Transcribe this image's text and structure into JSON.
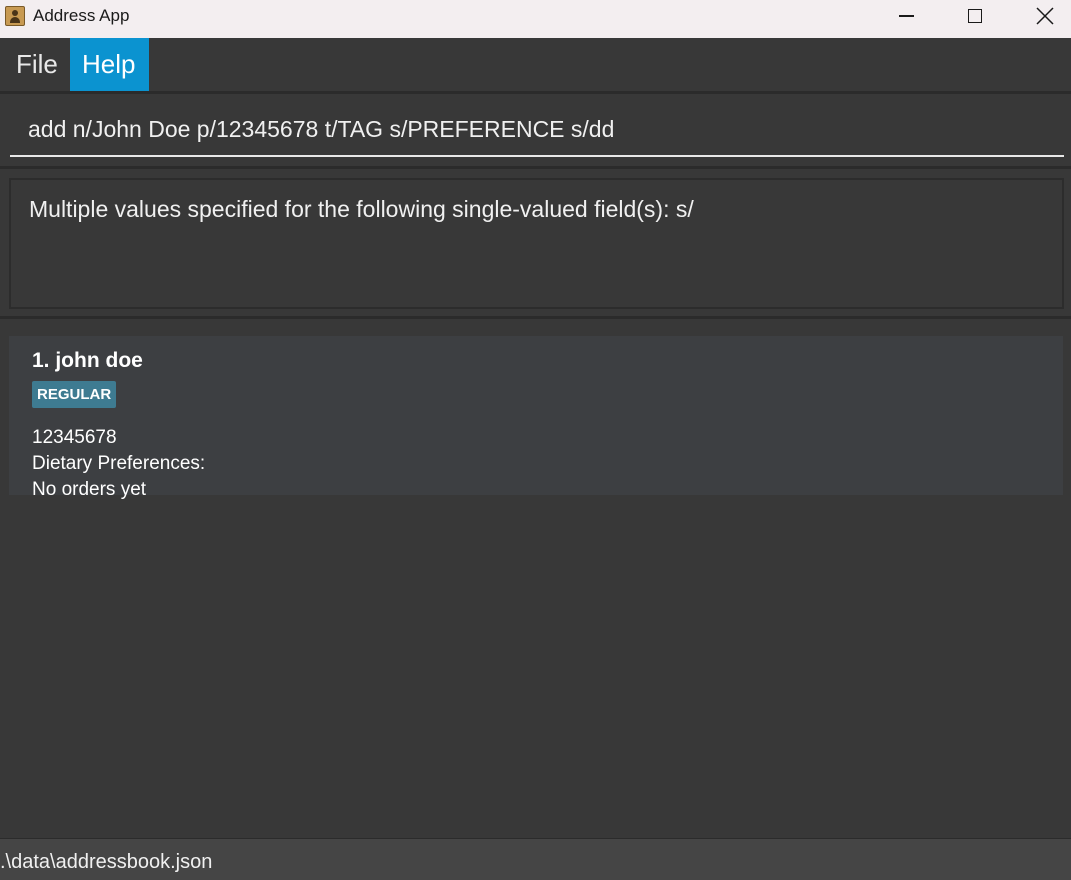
{
  "window": {
    "title": "Address App",
    "icon": "address-book-icon",
    "controls": [
      "minimize-icon",
      "maximize-icon",
      "close-icon"
    ]
  },
  "menu": {
    "items": [
      {
        "label": "File",
        "active": false
      },
      {
        "label": "Help",
        "active": true
      }
    ],
    "active_color": "#0b93d0"
  },
  "command": {
    "value": "add n/John Doe p/12345678 t/TAG s/PREFERENCE s/dd"
  },
  "result": {
    "message": "Multiple values specified for the following single-valued field(s): s/"
  },
  "persons": [
    {
      "index_name": "1. john doe",
      "tag": "REGULAR",
      "phone": "12345678",
      "dietary": "Dietary Preferences:",
      "orders": "No orders yet"
    }
  ],
  "status": {
    "path": ".\\data\\addressbook.json"
  },
  "colors": {
    "background": "#383838",
    "tag": "#3e7b91",
    "card": "#3d3f42"
  }
}
